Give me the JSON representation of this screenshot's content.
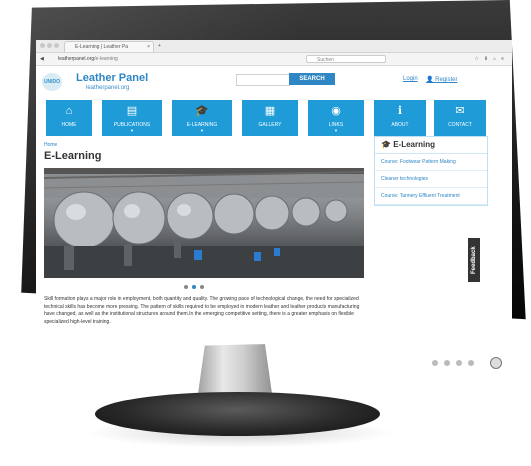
{
  "browser": {
    "tab_title": "E-Learning | Leather Pa",
    "tab_close": "×",
    "new_tab": "+",
    "url_domain": "leatherpanel.org",
    "url_path": "/e-learning",
    "search_placeholder": "Suchen"
  },
  "site": {
    "logo_text": "UNIDO",
    "title": "Leather Panel",
    "subtitle": "leatherpanel.org",
    "search_button": "SEARCH",
    "login": "Login",
    "register": "Register"
  },
  "menu": {
    "items": [
      {
        "label": "HOME",
        "icon": "home-icon"
      },
      {
        "label": "PUBLICATIONS",
        "icon": "book-icon"
      },
      {
        "label": "E-LEARNING",
        "icon": "graduation-cap-icon"
      },
      {
        "label": "GALLERY",
        "icon": "film-icon"
      },
      {
        "label": "LINKS",
        "icon": "globe-icon"
      },
      {
        "label": "ABOUT",
        "icon": "info-icon"
      },
      {
        "label": "CONTACT",
        "icon": "envelope-icon"
      }
    ],
    "accent": "#1f9bd7"
  },
  "content": {
    "breadcrumb": "Home",
    "title": "E-Learning",
    "intro": "Skill formation plays a major role in employment, both quantity and quality. The growing pace of technological change, the need for specialized technical skills has become more pressing. The pattern of skills required to be employed in modern leather and leather products manufacturing have changed, as well as the institutional structures around them.In the emerging competitive setting, there is a greater emphasis on flexible specialized high-level training."
  },
  "sidebar": {
    "title": "E-Learning",
    "items": [
      "Course: Footwear Pattern Making",
      "Cleaner technologies",
      "Course: Tannery Effluent Treatment"
    ]
  },
  "feedback_label": "Feedback"
}
